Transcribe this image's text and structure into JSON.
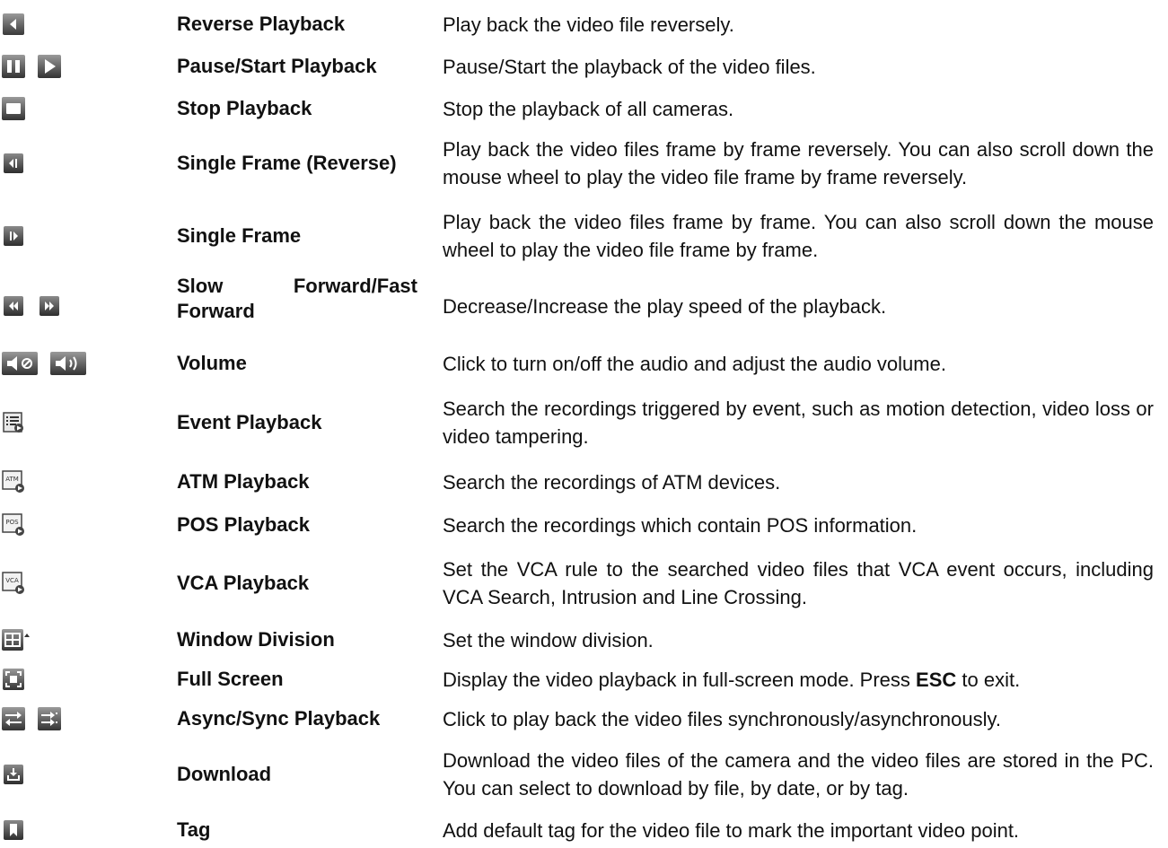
{
  "controls": [
    {
      "icons": [
        "reverse-play-icon"
      ],
      "name": "Reverse Playback",
      "description": "Play back the video file reversely."
    },
    {
      "icons": [
        "pause-icon",
        "play-icon"
      ],
      "name": "Pause/Start Playback",
      "description": "Pause/Start the playback of the video files."
    },
    {
      "icons": [
        "stop-icon"
      ],
      "name": "Stop Playback",
      "description": "Stop the playback of all cameras."
    },
    {
      "icons": [
        "single-frame-reverse-icon"
      ],
      "name": "Single Frame (Reverse)",
      "description": "Play back the video files frame by frame reversely. You can also scroll down the mouse wheel to play the video file frame by frame reversely."
    },
    {
      "icons": [
        "single-frame-icon"
      ],
      "name": "Single Frame",
      "description": "Play back the video files frame by frame. You can also scroll down the mouse wheel to play the video file frame by frame."
    },
    {
      "icons": [
        "slow-forward-icon",
        "fast-forward-icon"
      ],
      "name": "Slow Forward/Fast Forward",
      "description": "Decrease/Increase the play speed of the playback."
    },
    {
      "icons": [
        "mute-icon",
        "volume-icon"
      ],
      "name": "Volume",
      "description": "Click to turn on/off the audio and adjust the audio volume."
    },
    {
      "icons": [
        "event-playback-icon"
      ],
      "name": "Event Playback",
      "description": "Search the recordings triggered by event, such as motion detection, video loss or video tampering."
    },
    {
      "icons": [
        "atm-playback-icon"
      ],
      "name": "ATM Playback",
      "description": "Search the recordings of ATM devices."
    },
    {
      "icons": [
        "pos-playback-icon"
      ],
      "name": "POS Playback",
      "description": "Search the recordings which contain POS information."
    },
    {
      "icons": [
        "vca-playback-icon"
      ],
      "name": "VCA Playback",
      "description": "Set the VCA rule to the searched video files that VCA event occurs, including VCA Search, Intrusion and Line Crossing."
    },
    {
      "icons": [
        "window-division-icon"
      ],
      "name": "Window Division",
      "description": "Set the window division."
    },
    {
      "icons": [
        "full-screen-icon"
      ],
      "name": "Full Screen",
      "description_before": "Display the video playback in full-screen mode. Press ",
      "description_key": "ESC",
      "description_after": " to exit."
    },
    {
      "icons": [
        "async-icon",
        "sync-icon"
      ],
      "name": "Async/Sync Playback",
      "description": "Click to play back the video files synchronously/asynchronously."
    },
    {
      "icons": [
        "download-icon"
      ],
      "name": "Download",
      "description": "Download the video files of the camera and the video files are stored in the PC. You can select to download by file, by date, or by tag."
    },
    {
      "icons": [
        "tag-icon"
      ],
      "name": "Tag",
      "description": "Add default tag for the video file to mark the important video point."
    }
  ]
}
